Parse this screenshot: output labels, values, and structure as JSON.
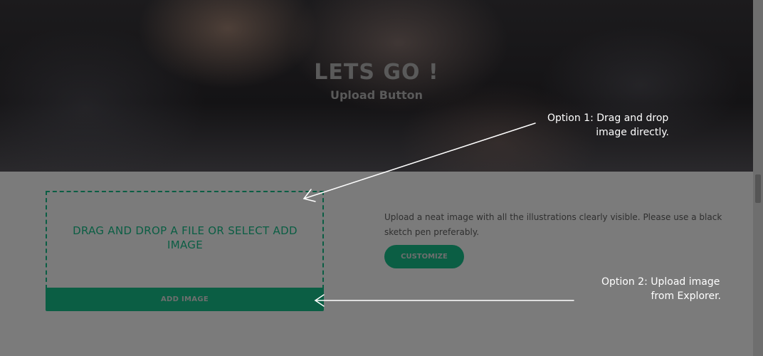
{
  "hero": {
    "title": "LETS GO !",
    "subtitle": "Upload Button"
  },
  "upload": {
    "dropzone_label": "DRAG AND DROP A FILE OR SELECT ADD IMAGE",
    "add_button_label": "ADD IMAGE"
  },
  "details": {
    "description": "Upload a neat image with all the illustrations clearly visible. Please use a black sketch pen preferably.",
    "customize_label": "CUSTOMIZE"
  },
  "annotations": {
    "option1_line1": "Option 1: Drag and drop",
    "option1_line2": "image directly.",
    "option2_line1": "Option 2: Upload image",
    "option2_line2": "from Explorer."
  },
  "colors": {
    "accent": "#0b5e44",
    "overlay_gray": "#7b7b7b",
    "annotation_text": "#ffffff"
  }
}
